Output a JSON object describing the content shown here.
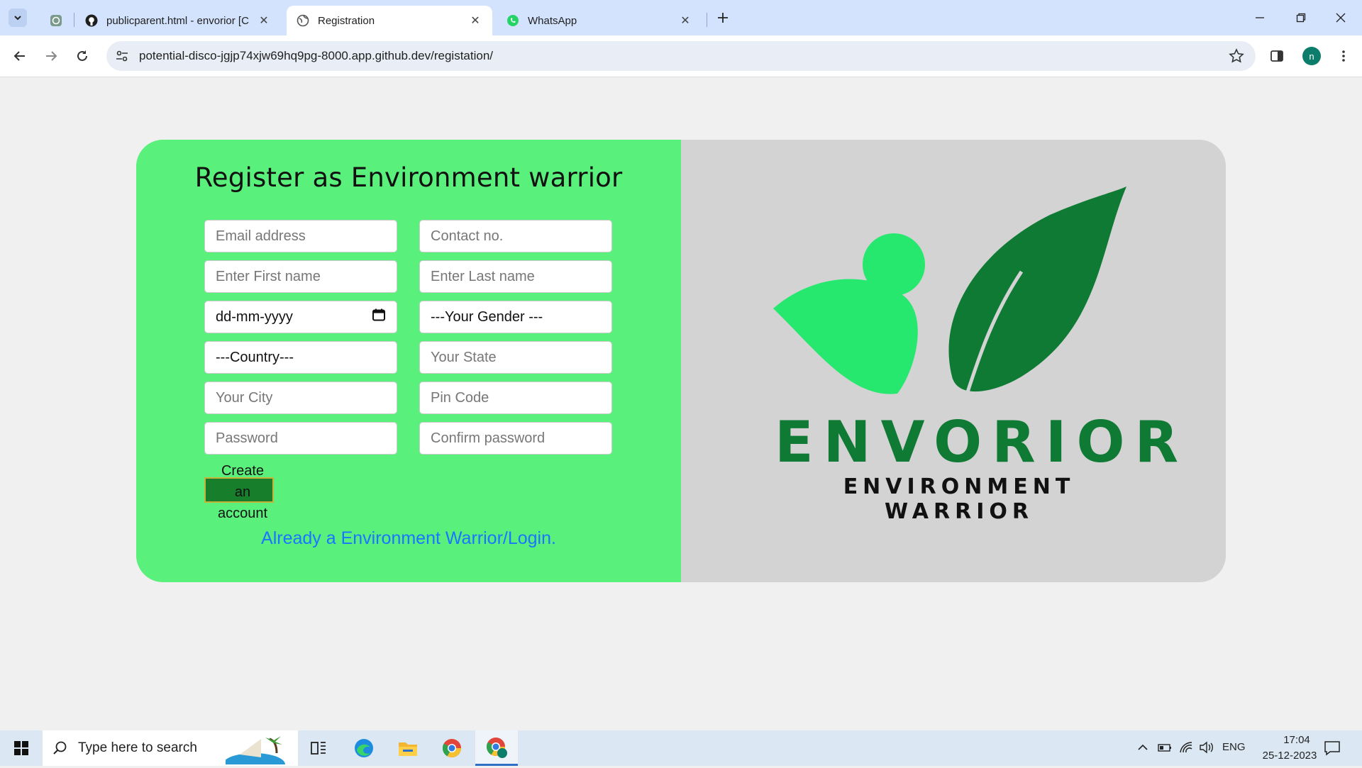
{
  "browser": {
    "tabs": [
      {
        "title": "",
        "icon": "chatgpt-icon"
      },
      {
        "title": "publicparent.html - envorior [C",
        "icon": "github-icon"
      },
      {
        "title": "Registration",
        "icon": "globe-icon",
        "active": true
      },
      {
        "title": "WhatsApp",
        "icon": "whatsapp-icon"
      }
    ],
    "url": "potential-disco-jgjp74xjw69hq9pg-8000.app.github.dev/registation/",
    "profile_initial": "n"
  },
  "page": {
    "title": "Register as Environment warrior",
    "fields": {
      "email_placeholder": "Email address",
      "contact_placeholder": "Contact no.",
      "first_name_placeholder": "Enter First name",
      "last_name_placeholder": "Enter Last name",
      "dob_placeholder": "dd-mm-yyyy",
      "gender_selected": "---Your Gender ---",
      "country_selected": "---Country---",
      "state_placeholder": "Your State",
      "city_placeholder": "Your City",
      "pin_placeholder": "Pin Code",
      "password_placeholder": "Password",
      "confirm_password_placeholder": "Confirm password"
    },
    "create_button_label": "Create an account",
    "create_button_lines": [
      "Create",
      "an",
      "account"
    ],
    "login_link": "Already a Environment Warrior/Login.",
    "logo": {
      "wordmark": "ENVORIOR",
      "tagline": "ENVIRONMENT WARRIOR"
    },
    "colors": {
      "form_bg": "#5af07c",
      "logo_bg": "#d3d3d3",
      "button_bg": "#177e2c",
      "link": "#1a75ff",
      "leaf_dark": "#0e7a33",
      "leaf_light": "#26e86e"
    }
  },
  "taskbar": {
    "search_placeholder": "Type here to search",
    "language": "ENG",
    "time": "17:04",
    "date": "25-12-2023"
  }
}
